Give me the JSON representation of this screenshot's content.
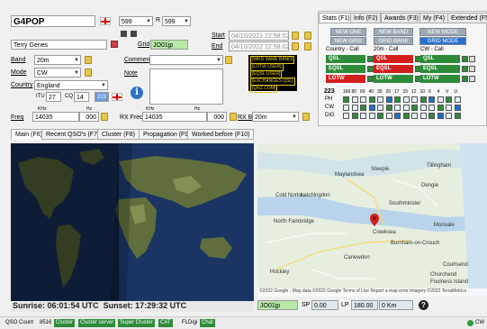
{
  "entry": {
    "callsign": "G4POP",
    "rst_sent": "599",
    "rst_rcvd_label": "R",
    "rst_rcvd": "599",
    "name": "Terry Genes",
    "grid_label": "Grid",
    "grid": "JO01jp",
    "start_label": "Start",
    "start": "04/10/2022 22:58:02",
    "end_label": "End",
    "end": "04/10/2022 22:58:02",
    "band_label": "Band",
    "band": "20m",
    "mode_label": "Mode",
    "mode": "CW",
    "country_label": "Country",
    "country": "England",
    "comment_label": "Comment",
    "note_label": "Note",
    "itu_label": "ITU",
    "itu": "27",
    "cq_label": "CQ",
    "cq": "14",
    "cq_num": "223",
    "khz1": "KHz",
    "hz1": "Hz",
    "khz2": "KHz",
    "hz2": "Hz",
    "freq_label": "Freq",
    "freq_khz": "14035",
    "freq_hz": "000",
    "rx_freq_label": "RX Freq",
    "rx_freq_khz": "14035",
    "rx_freq_hz": "000",
    "rx_band_label": "RX Band",
    "rx_band": "20m",
    "tags": [
      "[WKD SAME BAND]",
      "[LOTW USER]",
      "[EQSL USER]",
      "[EXCHANGES QSL]",
      "[QRZ.COM]"
    ],
    "info_icon": "info-icon"
  },
  "stats": {
    "tabs": [
      "Stats (F1)",
      "Info (F2)",
      "Awards (F3)",
      "My (F4)",
      "Extended (F5"
    ],
    "buttons_row1": [
      "NEW ONE",
      "NEW BAND",
      "NEW MODE"
    ],
    "buttons_row2": [
      "NEW GRID",
      "GRID BANK",
      "GRID MODE"
    ],
    "col_headers": [
      "Country - Call",
      "20m - Call",
      "CW - Call"
    ],
    "rows": [
      "QSL",
      "EQSL",
      "LOTW"
    ],
    "colors": {
      "green": "#2e8b3a",
      "red": "#d41f1f",
      "blue": "#1e6fd0"
    },
    "band_count": "223",
    "bands": [
      "160",
      "80",
      "60",
      "40",
      "30",
      "20",
      "17",
      "15",
      "12",
      "10",
      "6",
      "4",
      "V",
      "U"
    ],
    "band_rows": [
      "PH",
      "CW",
      "DIG"
    ]
  },
  "bottom_tabs": [
    "Main (F6)",
    "Recent QSO's (F7)",
    "Cluster (F8)",
    "Propagation (F9)",
    "Worked before (F10)"
  ],
  "map": {
    "sunrise": "Sunrise: 06:01:54 UTC",
    "sunset": "Sunset: 17:29:32 UTC",
    "towns": [
      "Steeple",
      "Tillingham",
      "Maylandsea",
      "Dengie",
      "Cold Norton",
      "Latchingdon",
      "Southminster",
      "North Fambridge",
      "Creeksea",
      "Monsale",
      "Burnham-on-Crouch",
      "Canewdon",
      "Hockley",
      "Courtsend",
      "Churchend",
      "Foulness Island"
    ],
    "attribution": "©2022 Google - Map data ©2022 Google  Terms of Use  Report a map error  Imagery ©2022 TerraMetrics",
    "grid_field": "JO01jp",
    "sp_label": "SP",
    "sp": "0.00",
    "lp_label": "LP",
    "lp": "180.00",
    "km": "0 Km",
    "help_icon": "help-icon"
  },
  "status": {
    "qso_count_label": "QSO Count",
    "qso_count": "8516",
    "buttons": [
      "Cluster",
      "Cluster server",
      "Super Cluster",
      "CAT",
      "FLDigi",
      "Chat"
    ],
    "right": "CW"
  }
}
